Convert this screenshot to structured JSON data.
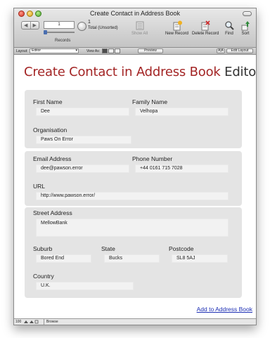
{
  "window": {
    "title": "Create Contact in Address Book"
  },
  "toolbar": {
    "record_number": "1",
    "record_total": "1",
    "record_status": "Total (Unsorted)",
    "records_label": "Records",
    "buttons": {
      "show_all": "Show All",
      "new_record": "New Record",
      "delete_record": "Delete Record",
      "find": "Find",
      "sort": "Sort"
    }
  },
  "layoutbar": {
    "layout_label": "Layout:",
    "layout_value": "Editor",
    "view_as_label": "View As:",
    "preview_button": "Preview",
    "text_size_button": "A|A",
    "edit_layout_button": "Edit Layout"
  },
  "page": {
    "title_accent": "Create Contact in Address Book",
    "title_rest": "Editor"
  },
  "form": {
    "first_name": {
      "label": "First Name",
      "value": "Dee"
    },
    "family_name": {
      "label": "Family Name",
      "value": "Velhopa"
    },
    "organisation": {
      "label": "Organisation",
      "value": "Paws On Error"
    },
    "email": {
      "label": "Email Address",
      "value": "dee@pawson.error"
    },
    "phone": {
      "label": "Phone Number",
      "value": "+44 0161 715 7028"
    },
    "url": {
      "label": "URL",
      "value": "http://www.pawson.error/"
    },
    "street": {
      "label": "Street Address",
      "value": "MellowBank"
    },
    "suburb": {
      "label": "Suburb",
      "value": "Bored End"
    },
    "state": {
      "label": "State",
      "value": "Bucks"
    },
    "postcode": {
      "label": "Postcode",
      "value": "SL8 5AJ"
    },
    "country": {
      "label": "Country",
      "value": "U.K."
    }
  },
  "actions": {
    "add_to_address_book": "Add to Address Book"
  },
  "statusbar": {
    "zoom": "100",
    "mode": "Browse"
  },
  "colors": {
    "title_accent": "#a32525",
    "link": "#1d2fb4",
    "panel": "#e4e4e4"
  }
}
